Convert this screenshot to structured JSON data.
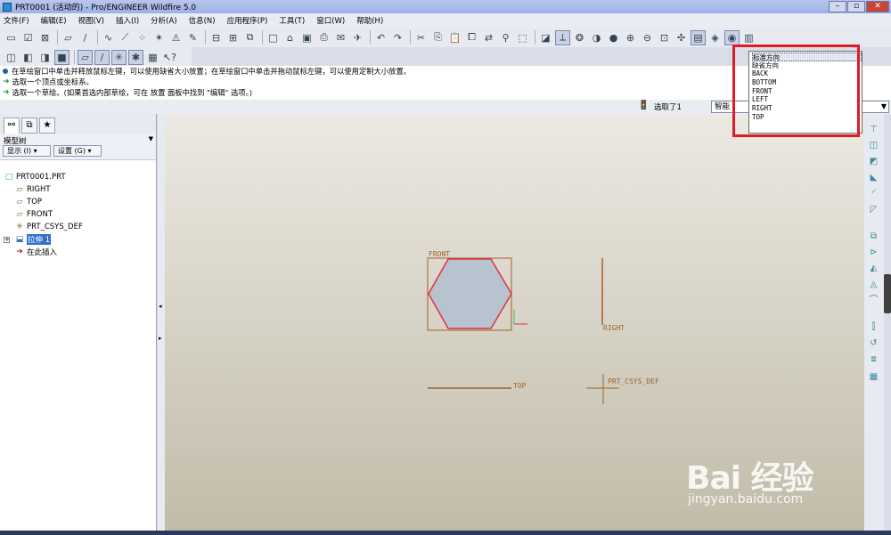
{
  "window": {
    "title": "PRT0001 (活动的) - Pro/ENGINEER Wildfire 5.0"
  },
  "menu": [
    "文件(F)",
    "编辑(E)",
    "视图(V)",
    "插入(I)",
    "分析(A)",
    "信息(N)",
    "应用程序(P)",
    "工具(T)",
    "窗口(W)",
    "帮助(H)"
  ],
  "messages": {
    "m1": "在草绘窗口中单击并释放鼠标左键，可以使用缺省大小放置；在草绘窗口中单击并拖动鼠标左键，可以使用定制大小放置。",
    "m2": "选取一个顶点或坐标系。",
    "m3": "选取一个草绘。(如果首选内部草绘，可在 放置 面板中找到 \"编辑\" 选项。)"
  },
  "status": {
    "selected": "选取了1",
    "filter": "智能"
  },
  "model_tree": {
    "label": "模型树",
    "show_button": "显示 (I) ▾",
    "settings_button": "设置 (G) ▾",
    "items": [
      "PRT0001.PRT",
      "RIGHT",
      "TOP",
      "FRONT",
      "PRT_CSYS_DEF",
      "拉伸 1",
      "在此插入"
    ]
  },
  "canvas_labels": {
    "front": "FRONT",
    "right": "RIGHT",
    "top": "TOP",
    "csys": "PRT_CSYS_DEF"
  },
  "view_list": [
    "标准方向",
    "缺省方向",
    "BACK",
    "BOTTOM",
    "FRONT",
    "LEFT",
    "RIGHT",
    "TOP"
  ],
  "watermark": {
    "logo": "Bai 经验",
    "url": "jingyan.baidu.com"
  },
  "colors": {
    "highlight": "#2f6fd0",
    "redbox": "#e21a24",
    "datum": "#a0622a",
    "hexagon_fill": "#b7c4cf",
    "hexagon_edge": "#e0304a"
  }
}
